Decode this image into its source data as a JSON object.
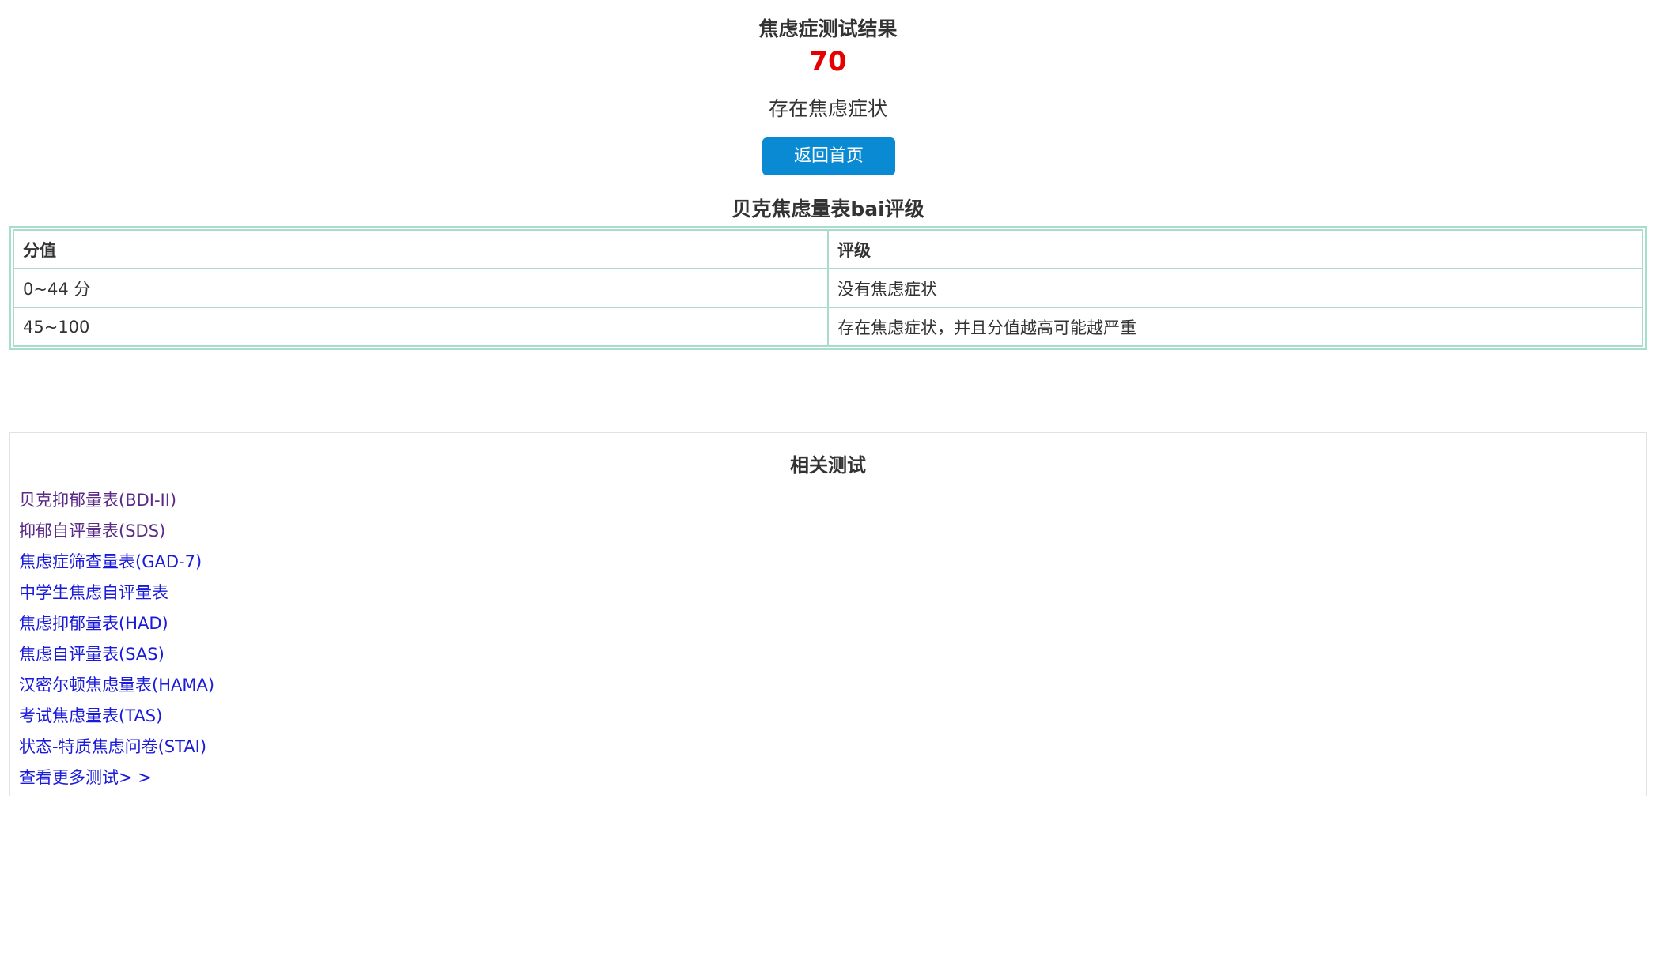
{
  "result": {
    "title": "焦虑症测试结果",
    "score": "70",
    "description": "存在焦虑症状",
    "home_button_label": "返回首页"
  },
  "scale_table": {
    "title": "贝克焦虑量表bai评级",
    "headers": [
      "分值",
      "评级"
    ],
    "rows": [
      [
        "0~44 分",
        "没有焦虑症状"
      ],
      [
        "45~100",
        "存在焦虑症状，并且分值越高可能越严重"
      ]
    ]
  },
  "related_tests": {
    "title": "相关测试",
    "links": [
      "贝克抑郁量表(BDI-II)",
      "抑郁自评量表(SDS)",
      "焦虑症筛查量表(GAD-7)",
      "中学生焦虑自评量表",
      "焦虑抑郁量表(HAD)",
      "焦虑自评量表(SAS)",
      "汉密尔顿焦虑量表(HAMA)",
      "考试焦虑量表(TAS)",
      "状态-特质焦虑问卷(STAI)"
    ],
    "more_label": "查看更多测试> >"
  },
  "colors": {
    "score": "#e60000",
    "button_bg": "#0a8ad2",
    "table_border": "#a9dcc9",
    "link_visited": "#5b2a86",
    "link": "#1a1adb"
  }
}
